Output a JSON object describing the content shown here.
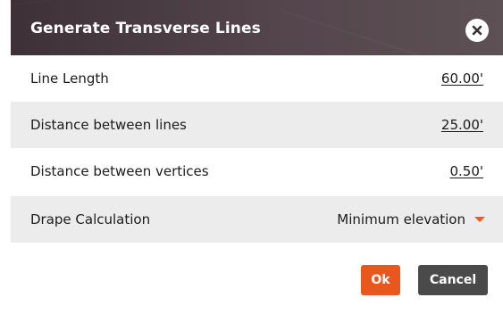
{
  "dialog": {
    "title": "Generate Transverse Lines",
    "close_icon": "close-icon"
  },
  "fields": [
    {
      "label": "Line Length",
      "value": "60.00'"
    },
    {
      "label": "Distance between lines",
      "value": "25.00'"
    },
    {
      "label": "Distance between vertices",
      "value": "0.50'"
    }
  ],
  "drape": {
    "label": "Drape Calculation",
    "selected": "Minimum elevation",
    "caret_icon": "caret-down-icon"
  },
  "buttons": {
    "ok_label": "Ok",
    "cancel_label": "Cancel"
  },
  "colors": {
    "header_bg": "#4e3f44",
    "accent": "#e9571c",
    "cancel_bg": "#4a4a4a",
    "row_shade": "#ececec"
  }
}
